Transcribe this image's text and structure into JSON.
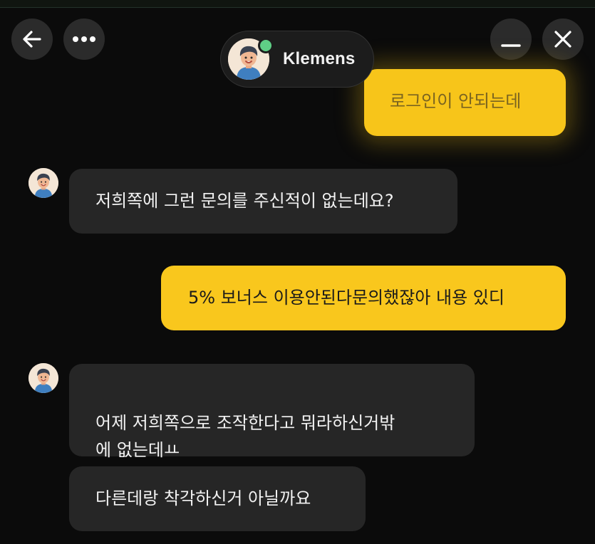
{
  "header": {
    "contact_name": "Klemens",
    "online": true,
    "icons": {
      "back": "arrow-left-icon",
      "more": "ellipsis-icon",
      "minimize": "minimize-icon",
      "close": "close-icon"
    }
  },
  "colors": {
    "background": "#0b0b0b",
    "incoming_bubble": "#262626",
    "outgoing_bubble": "#f9c71d",
    "online_indicator": "#5fcf86"
  },
  "messages": [
    {
      "direction": "outgoing",
      "text": "로그인이 안되는데"
    },
    {
      "direction": "incoming",
      "text": "저희쪽에 그런 문의를 주신적이 없는데요?"
    },
    {
      "direction": "outgoing",
      "text": "5% 보너스 이용안된다문의했잖아 내용 있디"
    },
    {
      "direction": "incoming",
      "text": "어제 저희쪽으로 조작한다고 뭐라하신거밖\n에 없는데ㅛ"
    },
    {
      "direction": "incoming",
      "text": "다른데랑 착각하신거 아닐까요"
    }
  ]
}
